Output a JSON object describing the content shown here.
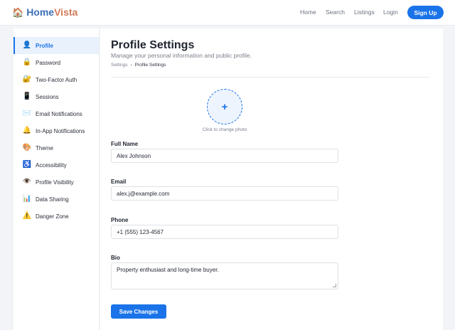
{
  "brand": {
    "house_icon": "house-icon",
    "home": "Home",
    "vista": "Vista"
  },
  "nav": {
    "home": "Home",
    "search": "Search",
    "listings": "Listings",
    "login": "Login",
    "signup": "Sign Up"
  },
  "sidebar": {
    "items": [
      {
        "label": "Profile",
        "icon": "👤",
        "active": true
      },
      {
        "label": "Password",
        "icon": "🔒"
      },
      {
        "label": "Two-Factor Auth",
        "icon": "🔐"
      },
      {
        "label": "Sessions",
        "icon": "📱"
      },
      {
        "label": "Email Notifications",
        "icon": "✉️"
      },
      {
        "label": "In-App Notifications",
        "icon": "🔔"
      },
      {
        "label": "Theme",
        "icon": "🎨"
      },
      {
        "label": "Accessibility",
        "icon": "♿"
      },
      {
        "label": "Profile Visibility",
        "icon": "👁️"
      },
      {
        "label": "Data Sharing",
        "icon": "📊"
      },
      {
        "label": "Danger Zone",
        "icon": "⚠️"
      }
    ]
  },
  "main": {
    "title": "Profile Settings",
    "subtitle": "Manage your personal information and public profile.",
    "breadcrumb": {
      "parent": "Settings",
      "sep": "›",
      "current": "Profile Settings"
    },
    "avatar": {
      "plus": "+",
      "caption": "Click to change photo"
    },
    "fields": {
      "full_name_label": "Full Name",
      "full_name_value": "Alex Johnson",
      "email_label": "Email",
      "email_value": "alex.j@example.com",
      "phone_label": "Phone",
      "phone_value": "+1 (555) 123-4567",
      "bio_label": "Bio",
      "bio_value": "Property enthusiast and long-time buyer."
    },
    "save_label": "Save Changes"
  },
  "colors": {
    "accent": "#1a73e8",
    "brand_home": "#3d6fb6",
    "brand_vista": "#d27a5a"
  }
}
